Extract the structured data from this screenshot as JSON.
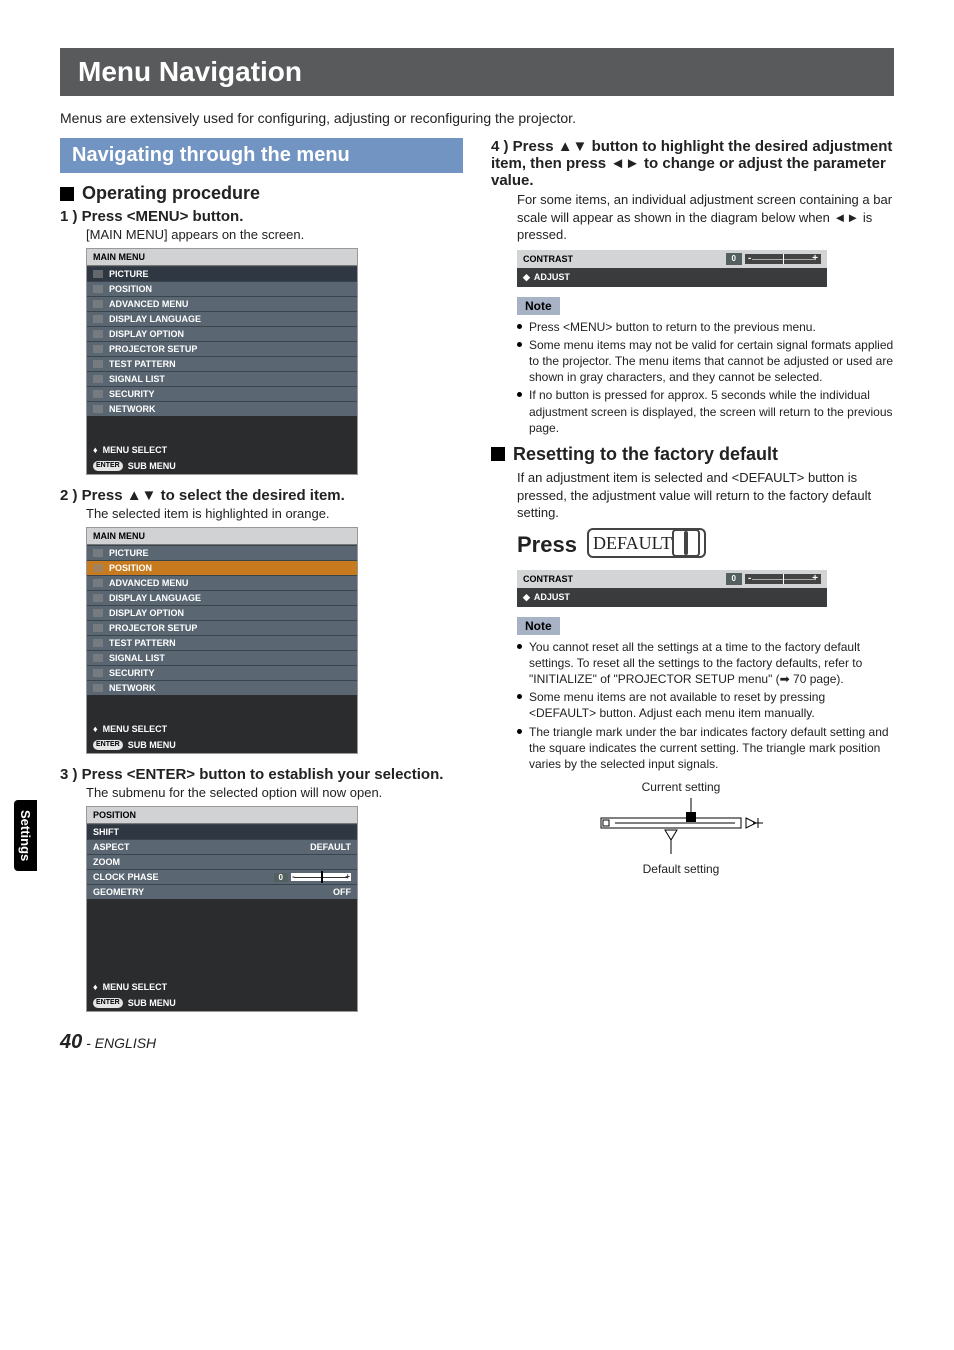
{
  "title": "Menu Navigation",
  "intro": "Menus are extensively used for configuring, adjusting or reconfiguring the projector.",
  "nav_heading": "Navigating through the menu",
  "operating_heading": "Operating procedure",
  "resetting_heading": "Resetting to the factory default",
  "steps": {
    "s1_line": "1 ) Press <MENU> button.",
    "s1_sub": "[MAIN MENU] appears on the screen.",
    "s2_line": "2 ) Press ▲▼ to select the desired item.",
    "s2_sub": "The selected item is highlighted in orange.",
    "s3_line": "3 ) Press <ENTER> button to establish your selection.",
    "s3_sub": "The submenu for the selected option will now open.",
    "s4_line": "4 ) Press ▲▼ button to highlight the desired adjustment item, then press ◄► to change or adjust the parameter value.",
    "s4_sub": "For some items, an individual adjustment screen containing a bar scale will appear as shown in the diagram below when ◄► is pressed."
  },
  "osd_main_title": "MAIN MENU",
  "osd_main_items": [
    "PICTURE",
    "POSITION",
    "ADVANCED MENU",
    "DISPLAY LANGUAGE",
    "DISPLAY OPTION",
    "PROJECTOR SETUP",
    "TEST PATTERN",
    "SIGNAL LIST",
    "SECURITY",
    "NETWORK"
  ],
  "osd_footer_menu_select": "MENU SELECT",
  "osd_footer_sub_menu": "SUB MENU",
  "osd_footer_enter": "ENTER",
  "osd_position_title": "POSITION",
  "osd_position_rows": [
    {
      "label": "SHIFT",
      "value": ""
    },
    {
      "label": "ASPECT",
      "value": "DEFAULT"
    },
    {
      "label": "ZOOM",
      "value": ""
    },
    {
      "label": "CLOCK PHASE",
      "value": "0"
    },
    {
      "label": "GEOMETRY",
      "value": "OFF"
    }
  ],
  "contrast_bar": {
    "label": "CONTRAST",
    "value": "0",
    "action": "ADJUST"
  },
  "note_label": "Note",
  "notes1": [
    "Press <MENU> button to return to the previous menu.",
    "Some menu items may not be valid for certain signal formats applied to the projector. The menu items that cannot be adjusted or used are shown in gray characters, and they cannot be selected.",
    "If no button is pressed for approx. 5 seconds while the individual adjustment screen is displayed, the screen will return to the previous page."
  ],
  "reset_body": "If an adjustment item is selected and <DEFAULT> button is pressed, the adjustment value will return to the factory default setting.",
  "press_label": "Press",
  "default_label": "DEFAULT",
  "notes2": [
    "You cannot reset all the settings at a time to the factory default settings. To reset all the settings to the factory defaults, refer to \"INITIALIZE\" of \"PROJECTOR SETUP menu\" (➡ 70 page).",
    "Some menu items are not available to reset by pressing <DEFAULT> button. Adjust each menu item manually.",
    "The triangle mark under the bar indicates factory default setting and the square indicates the current setting. The triangle mark position varies by the selected input signals."
  ],
  "diagram": {
    "current": "Current setting",
    "default": "Default setting"
  },
  "side_tab": "Settings",
  "footer_page": "40",
  "footer_lang": "- ENGLISH"
}
